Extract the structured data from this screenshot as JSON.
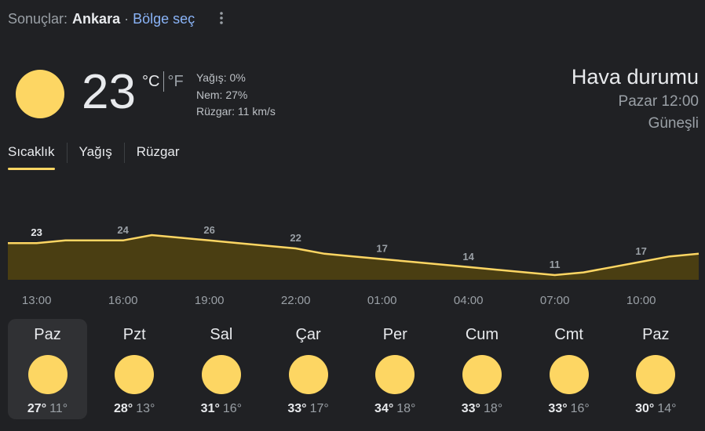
{
  "header": {
    "results_label": "Sonuçlar:",
    "location": "Ankara",
    "separator": "·",
    "select_region": "Bölge seç",
    "more_icon": "more-vert-icon"
  },
  "current": {
    "icon": "sun-icon",
    "temperature": "23",
    "unit_c": "°C",
    "unit_f": "°F",
    "precipitation": "Yağış: 0%",
    "humidity": "Nem: 27%",
    "wind": "Rüzgar: 11 km/s"
  },
  "title": {
    "heading": "Hava durumu",
    "datetime": "Pazar 12:00",
    "condition": "Güneşli"
  },
  "tabs": [
    {
      "label": "Sıcaklık",
      "active": true
    },
    {
      "label": "Yağış",
      "active": false
    },
    {
      "label": "Rüzgar",
      "active": false
    }
  ],
  "colors": {
    "accent": "#fdd663",
    "fill": "#4a3e12",
    "background": "#202124"
  },
  "chart_data": {
    "type": "area",
    "x": [
      "12:00",
      "13:00",
      "14:00",
      "15:00",
      "16:00",
      "17:00",
      "18:00",
      "19:00",
      "20:00",
      "21:00",
      "22:00",
      "23:00",
      "00:00",
      "01:00",
      "02:00",
      "03:00",
      "04:00",
      "05:00",
      "06:00",
      "07:00",
      "08:00",
      "09:00",
      "10:00",
      "11:00",
      "12:00"
    ],
    "values": [
      23,
      23,
      24,
      24,
      24,
      26,
      25,
      24,
      23,
      22,
      21,
      19,
      18,
      17,
      16,
      15,
      14,
      13,
      12,
      11,
      12,
      14,
      16,
      18,
      19
    ],
    "point_labels": [
      {
        "x": "13:00",
        "text": "23"
      },
      {
        "x": "16:00",
        "text": "24"
      },
      {
        "x": "19:00",
        "text": "26"
      },
      {
        "x": "22:00",
        "text": "22"
      },
      {
        "x": "01:00",
        "text": "17"
      },
      {
        "x": "04:00",
        "text": "14"
      },
      {
        "x": "07:00",
        "text": "11"
      },
      {
        "x": "10:00",
        "text": "17"
      }
    ],
    "x_ticks": [
      "13:00",
      "16:00",
      "19:00",
      "22:00",
      "01:00",
      "04:00",
      "07:00",
      "10:00"
    ],
    "ylim": [
      0,
      30
    ],
    "grid": false
  },
  "forecast": [
    {
      "day": "Paz",
      "icon": "sun-icon",
      "high": "27°",
      "low": "11°",
      "selected": true
    },
    {
      "day": "Pzt",
      "icon": "sun-icon",
      "high": "28°",
      "low": "13°",
      "selected": false
    },
    {
      "day": "Sal",
      "icon": "sun-icon",
      "high": "31°",
      "low": "16°",
      "selected": false
    },
    {
      "day": "Çar",
      "icon": "sun-icon",
      "high": "33°",
      "low": "17°",
      "selected": false
    },
    {
      "day": "Per",
      "icon": "sun-icon",
      "high": "34°",
      "low": "18°",
      "selected": false
    },
    {
      "day": "Cum",
      "icon": "sun-icon",
      "high": "33°",
      "low": "18°",
      "selected": false
    },
    {
      "day": "Cmt",
      "icon": "sun-icon",
      "high": "33°",
      "low": "16°",
      "selected": false
    },
    {
      "day": "Paz",
      "icon": "sun-icon",
      "high": "30°",
      "low": "14°",
      "selected": false
    }
  ]
}
